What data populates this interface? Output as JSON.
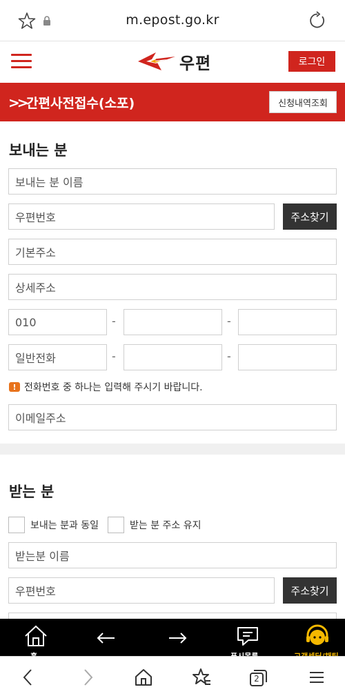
{
  "browser": {
    "url": "m.epost.go.kr",
    "tab_count": "2"
  },
  "header": {
    "logo_text": "우편",
    "login_label": "로그인"
  },
  "titlebar": {
    "title": "간편사전접수(소포)",
    "history_label": "신청내역조회"
  },
  "sender": {
    "heading": "보내는 분",
    "name_placeholder": "보내는 분 이름",
    "zip_placeholder": "우편번호",
    "search_label": "주소찾기",
    "addr1_placeholder": "기본주소",
    "addr2_placeholder": "상세주소",
    "mobile_prefix": "010",
    "phone_prefix": "일반전화",
    "dash": "-",
    "notice_badge": "!",
    "notice": "전화번호 중 하나는 입력해 주시기 바랍니다.",
    "email_placeholder": "이메일주소"
  },
  "receiver": {
    "heading": "받는 분",
    "same_as_sender": "보내는 분과 동일",
    "keep_address": "받는 분 주소 유지",
    "name_placeholder": "받는분 이름",
    "zip_placeholder": "우편번호",
    "search_label": "주소찾기"
  },
  "app_nav": {
    "home_label": "홈",
    "push_label": "푸시목록",
    "cs_label": "고객센터/채팅"
  },
  "colors": {
    "brand_red": "#d0251e",
    "dark_button": "#333333",
    "nav_bg": "#000000",
    "cs_yellow": "#f5b800"
  }
}
